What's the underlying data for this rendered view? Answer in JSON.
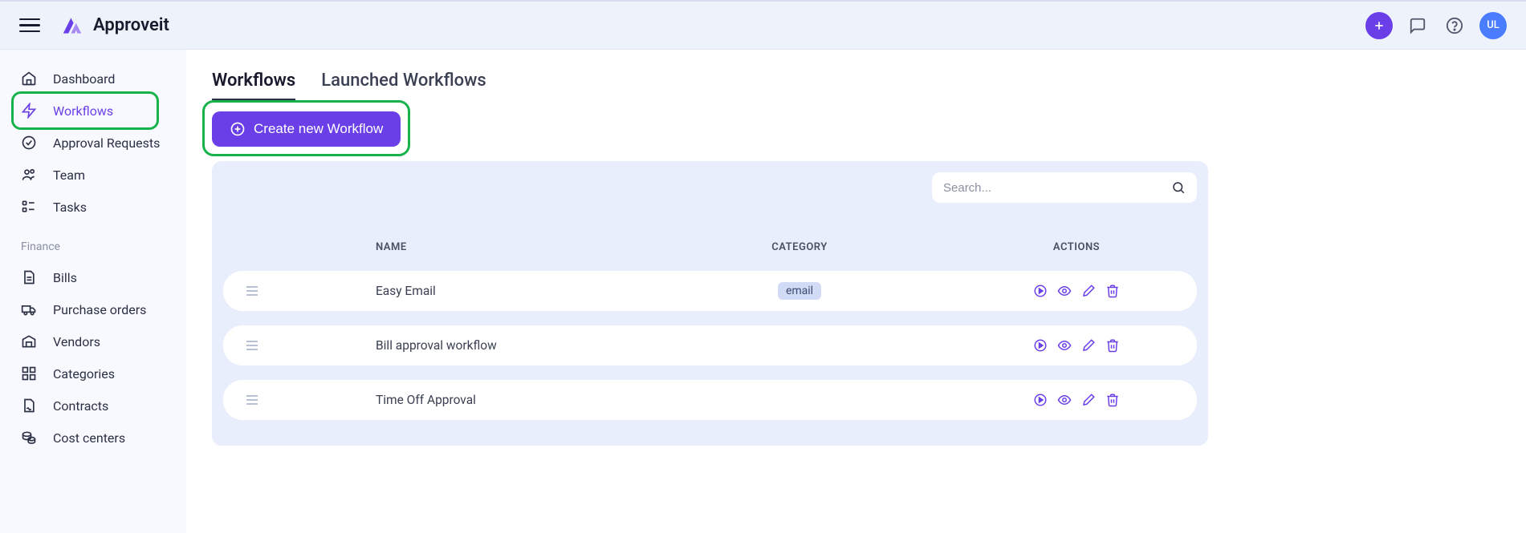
{
  "header": {
    "app_name": "Approveit",
    "avatar_initials": "UL"
  },
  "sidebar": {
    "main": [
      {
        "label": "Dashboard"
      },
      {
        "label": "Workflows",
        "active": true
      },
      {
        "label": "Approval Requests"
      },
      {
        "label": "Team"
      },
      {
        "label": "Tasks"
      }
    ],
    "finance_title": "Finance",
    "finance": [
      {
        "label": "Bills"
      },
      {
        "label": "Purchase orders"
      },
      {
        "label": "Vendors"
      },
      {
        "label": "Categories"
      },
      {
        "label": "Contracts"
      },
      {
        "label": "Cost centers"
      }
    ]
  },
  "main": {
    "tabs": [
      {
        "label": "Workflows",
        "active": true
      },
      {
        "label": "Launched Workflows",
        "active": false
      }
    ],
    "create_button_label": "Create new Workflow",
    "search_placeholder": "Search...",
    "columns": {
      "name": "NAME",
      "category": "CATEGORY",
      "actions": "ACTIONS"
    },
    "rows": [
      {
        "name": "Easy Email",
        "category": "email"
      },
      {
        "name": "Bill approval workflow",
        "category": ""
      },
      {
        "name": "Time Off Approval",
        "category": ""
      }
    ]
  },
  "colors": {
    "accent": "#6b3fe8",
    "highlight_border": "#17b34a",
    "avatar_bg": "#4a7cff",
    "panel_bg": "#e8eefb"
  }
}
